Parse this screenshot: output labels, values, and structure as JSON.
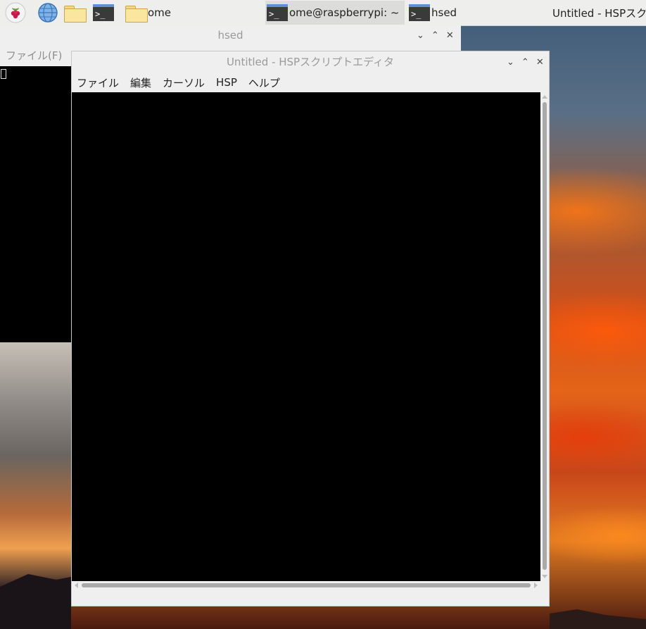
{
  "taskbar": {
    "tasks": [
      {
        "label": "ome"
      },
      {
        "label": "ome@raspberrypi: ~"
      },
      {
        "label": "hsed"
      },
      {
        "label": "Untitled - HSPスクリプトエディタ"
      }
    ]
  },
  "hsed_window": {
    "title": "hsed",
    "menu_file": "ファイル(F)"
  },
  "editor_window": {
    "title": "Untitled - HSPスクリプトエディタ",
    "menu": {
      "file": "ファイル",
      "edit": "編集",
      "cursor": "カーソル",
      "hsp": "HSP",
      "help": "ヘルプ"
    }
  },
  "window_buttons": {
    "minimize": "⌄",
    "maximize": "⌃",
    "close": "✕"
  },
  "colors": {
    "taskbar": "#eeeeec",
    "window_chrome": "#efefef",
    "editor_background": "#000000"
  },
  "icons": [
    "raspberry-menu-icon",
    "web-browser-icon",
    "file-manager-icon",
    "terminal-icon",
    "folder-icon"
  ]
}
